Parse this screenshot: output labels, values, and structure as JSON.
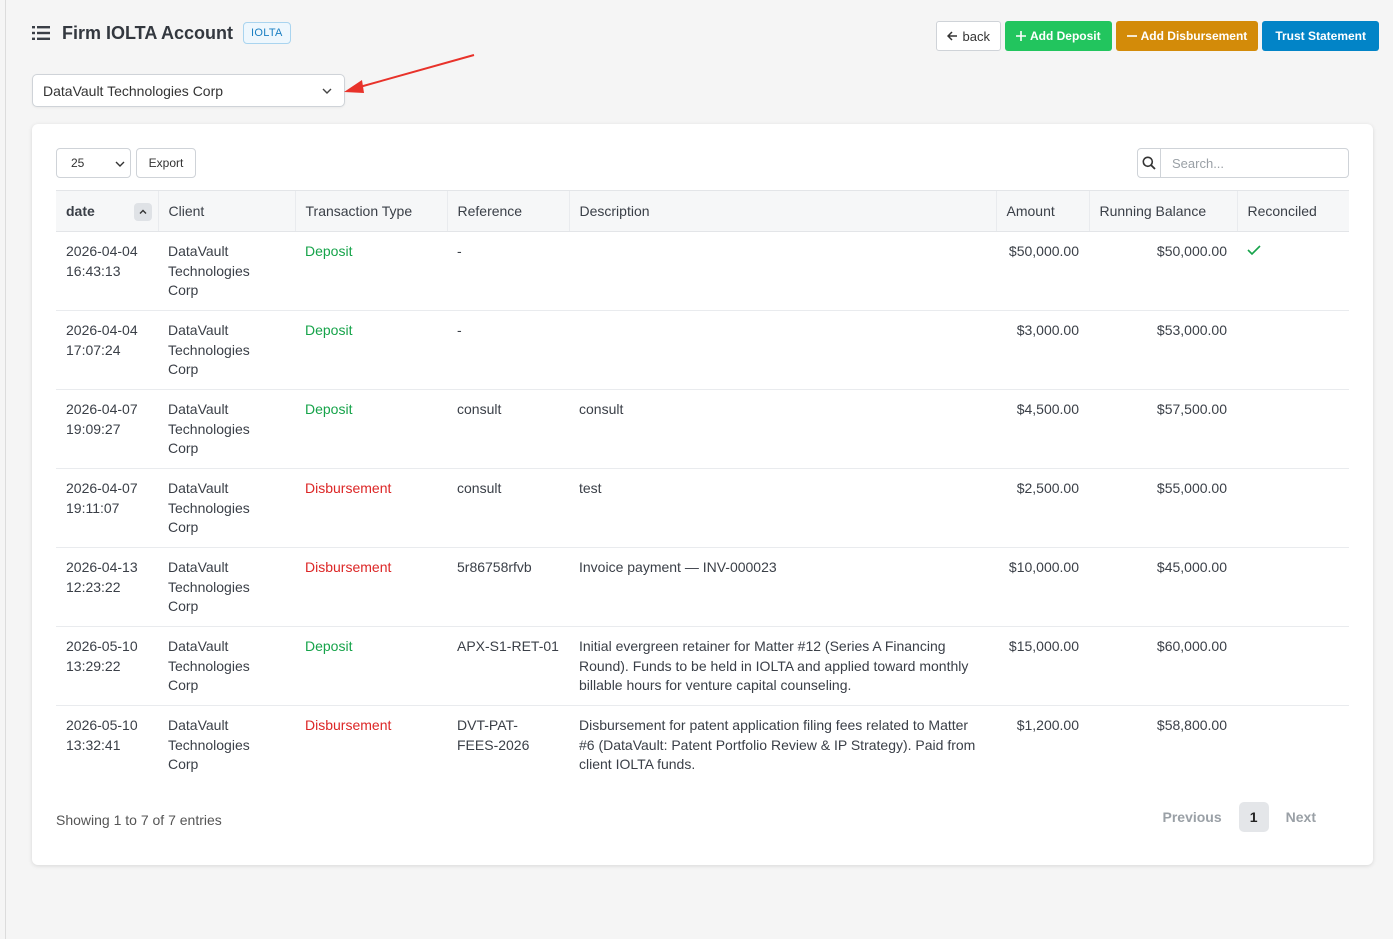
{
  "header": {
    "title": "Firm IOLTA Account",
    "badge": "IOLTA",
    "back_label": "back",
    "add_deposit_label": "Add Deposit",
    "add_disbursement_label": "Add Disbursement",
    "trust_statement_label": "Trust Statement"
  },
  "client_select": {
    "value": "DataVault Technologies Corp"
  },
  "table_controls": {
    "page_length": "25",
    "export_label": "Export",
    "search_placeholder": "Search..."
  },
  "table": {
    "columns": [
      "date",
      "Client",
      "Transaction Type",
      "Reference",
      "Description",
      "Amount",
      "Running Balance",
      "Reconciled"
    ],
    "rows": [
      {
        "date": "2026-04-04",
        "time": "16:43:13",
        "client_l1": "DataVault",
        "client_l2": "Technologies",
        "client_l3": "Corp",
        "type": "Deposit",
        "reference": "-",
        "description": "",
        "amount": "$50,000.00",
        "balance": "$50,000.00",
        "reconciled": "✓"
      },
      {
        "date": "2026-04-04",
        "time": "17:07:24",
        "client_l1": "DataVault",
        "client_l2": "Technologies",
        "client_l3": "Corp",
        "type": "Deposit",
        "reference": "-",
        "description": "",
        "amount": "$3,000.00",
        "balance": "$53,000.00",
        "reconciled": ""
      },
      {
        "date": "2026-04-07",
        "time": "19:09:27",
        "client_l1": "DataVault",
        "client_l2": "Technologies",
        "client_l3": "Corp",
        "type": "Deposit",
        "reference": "consult",
        "description": "consult",
        "amount": "$4,500.00",
        "balance": "$57,500.00",
        "reconciled": ""
      },
      {
        "date": "2026-04-07",
        "time": "19:11:07",
        "client_l1": "DataVault",
        "client_l2": "Technologies",
        "client_l3": "Corp",
        "type": "Disbursement",
        "reference": "consult",
        "description": "test",
        "amount": "$2,500.00",
        "balance": "$55,000.00",
        "reconciled": ""
      },
      {
        "date": "2026-04-13",
        "time": "12:23:22",
        "client_l1": "DataVault",
        "client_l2": "Technologies",
        "client_l3": "Corp",
        "type": "Disbursement",
        "reference": "5r86758rfvb",
        "description": "Invoice payment — INV-000023",
        "amount": "$10,000.00",
        "balance": "$45,000.00",
        "reconciled": ""
      },
      {
        "date": "2026-05-10",
        "time": "13:29:22",
        "client_l1": "DataVault",
        "client_l2": "Technologies",
        "client_l3": "Corp",
        "type": "Deposit",
        "reference": "APX-S1-RET-01",
        "description": "Initial evergreen retainer for Matter #12 (Series A Financing Round). Funds to be held in IOLTA and applied toward monthly billable hours for venture capital counseling.",
        "amount": "$15,000.00",
        "balance": "$60,000.00",
        "reconciled": ""
      },
      {
        "date": "2026-05-10",
        "time": "13:32:41",
        "client_l1": "DataVault",
        "client_l2": "Technologies",
        "client_l3": "Corp",
        "type": "Disbursement",
        "reference": "DVT-PAT-FEES-2026",
        "description": "Disbursement for patent application filing fees related to Matter #6 (DataVault: Patent Portfolio Review & IP Strategy). Paid from client IOLTA funds.",
        "amount": "$1,200.00",
        "balance": "$58,800.00",
        "reconciled": ""
      }
    ]
  },
  "footer": {
    "info": "Showing 1 to 7 of 7 entries",
    "previous_label": "Previous",
    "current_page": "1",
    "next_label": "Next"
  },
  "colors": {
    "deposit": "#16a34a",
    "disbursement": "#dc2626",
    "primary": "#0284c7",
    "success": "#22c55e",
    "warning": "#d38b09"
  },
  "icons": [
    "list-icon",
    "arrow-left-icon",
    "plus-icon",
    "minus-icon",
    "chevron-down-icon",
    "search-icon",
    "check-icon",
    "sort-up-icon"
  ]
}
